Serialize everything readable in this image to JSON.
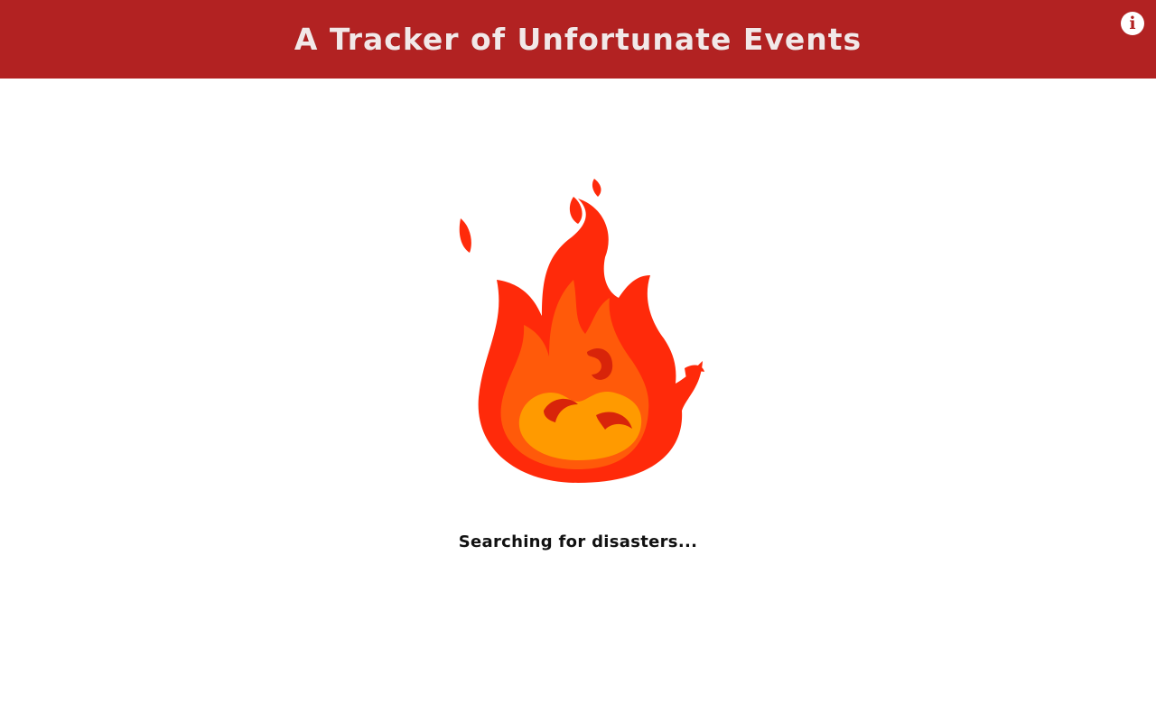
{
  "header": {
    "title": "A Tracker of Unfortunate Events",
    "info_icon": "info-icon",
    "info_label": "i"
  },
  "main": {
    "loading_icon": "fire-icon",
    "status_text": "Searching for disasters..."
  },
  "colors": {
    "header_bg": "#b22222",
    "flame_outer": "#ff2a0a",
    "flame_mid": "#ff5a0a",
    "flame_inner": "#ff9a00",
    "flame_shadow": "#d8240a"
  }
}
